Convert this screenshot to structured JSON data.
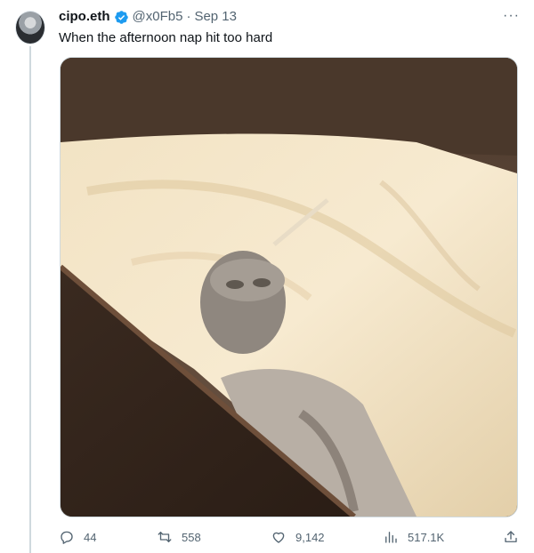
{
  "author": {
    "display_name": "cipo.eth",
    "handle": "@x0Fb5",
    "separator": "·",
    "date": "Sep 13",
    "verified_icon": "verified-badge-icon"
  },
  "more_label": "···",
  "tweet": {
    "text": "When the afternoon nap hit too hard"
  },
  "actions": {
    "replies": "44",
    "retweets": "558",
    "likes": "9,142",
    "views": "517.1K"
  },
  "colors": {
    "verified": "#1d9bf0",
    "secondary_text": "#536471",
    "divider": "#cfd9de"
  }
}
